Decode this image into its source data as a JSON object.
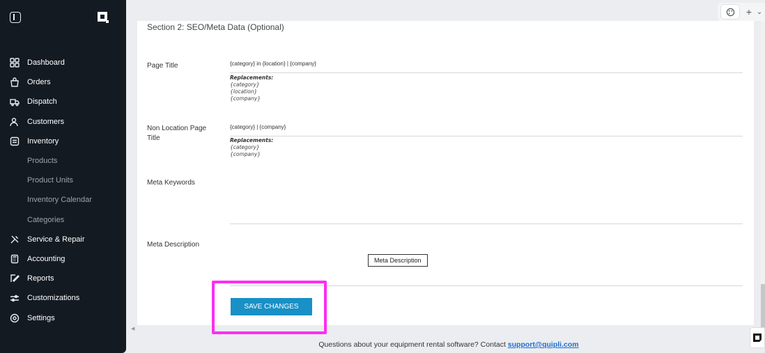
{
  "sidebar": {
    "items": [
      {
        "label": "Dashboard",
        "icon": "grid-icon"
      },
      {
        "label": "Orders",
        "icon": "bag-icon"
      },
      {
        "label": "Dispatch",
        "icon": "truck-icon"
      },
      {
        "label": "Customers",
        "icon": "users-icon"
      },
      {
        "label": "Inventory",
        "icon": "inventory-icon"
      },
      {
        "label": "Products",
        "sub": true
      },
      {
        "label": "Product Units",
        "sub": true
      },
      {
        "label": "Inventory Calendar",
        "sub": true
      },
      {
        "label": "Categories",
        "sub": true
      },
      {
        "label": "Service & Repair",
        "icon": "tools-icon"
      },
      {
        "label": "Accounting",
        "icon": "calculator-icon"
      },
      {
        "label": "Reports",
        "icon": "pencil-icon"
      },
      {
        "label": "Customizations",
        "icon": "sliders-icon"
      },
      {
        "label": "Settings",
        "icon": "gear-icon"
      }
    ]
  },
  "section": {
    "title": "Section 2: SEO/Meta Data (Optional)"
  },
  "fields": {
    "page_title": {
      "label": "Page Title",
      "value": "{category} in {location} | {company}",
      "replacements_header": "Replacements:",
      "replacements": [
        "{category}",
        "{location}",
        "{company}"
      ]
    },
    "non_location_title": {
      "label_line1": "Non Location Page",
      "label_line2": "Title",
      "value": "{category} | {company}",
      "replacements_header": "Replacements:",
      "replacements": [
        "{category}",
        "{company}"
      ]
    },
    "meta_keywords": {
      "label": "Meta Keywords"
    },
    "meta_description": {
      "label": "Meta Description",
      "tooltip": "Meta Description"
    }
  },
  "actions": {
    "save_label": "SAVE CHANGES"
  },
  "footer": {
    "text": "Questions about your equipment rental software? Contact ",
    "link": "support@quipli.com"
  },
  "topbar": {
    "plus": "+",
    "chevron": "⌄"
  },
  "colors": {
    "sidebar": "#141a22",
    "accent": "#1990c6",
    "highlight": "#ff2df2"
  }
}
